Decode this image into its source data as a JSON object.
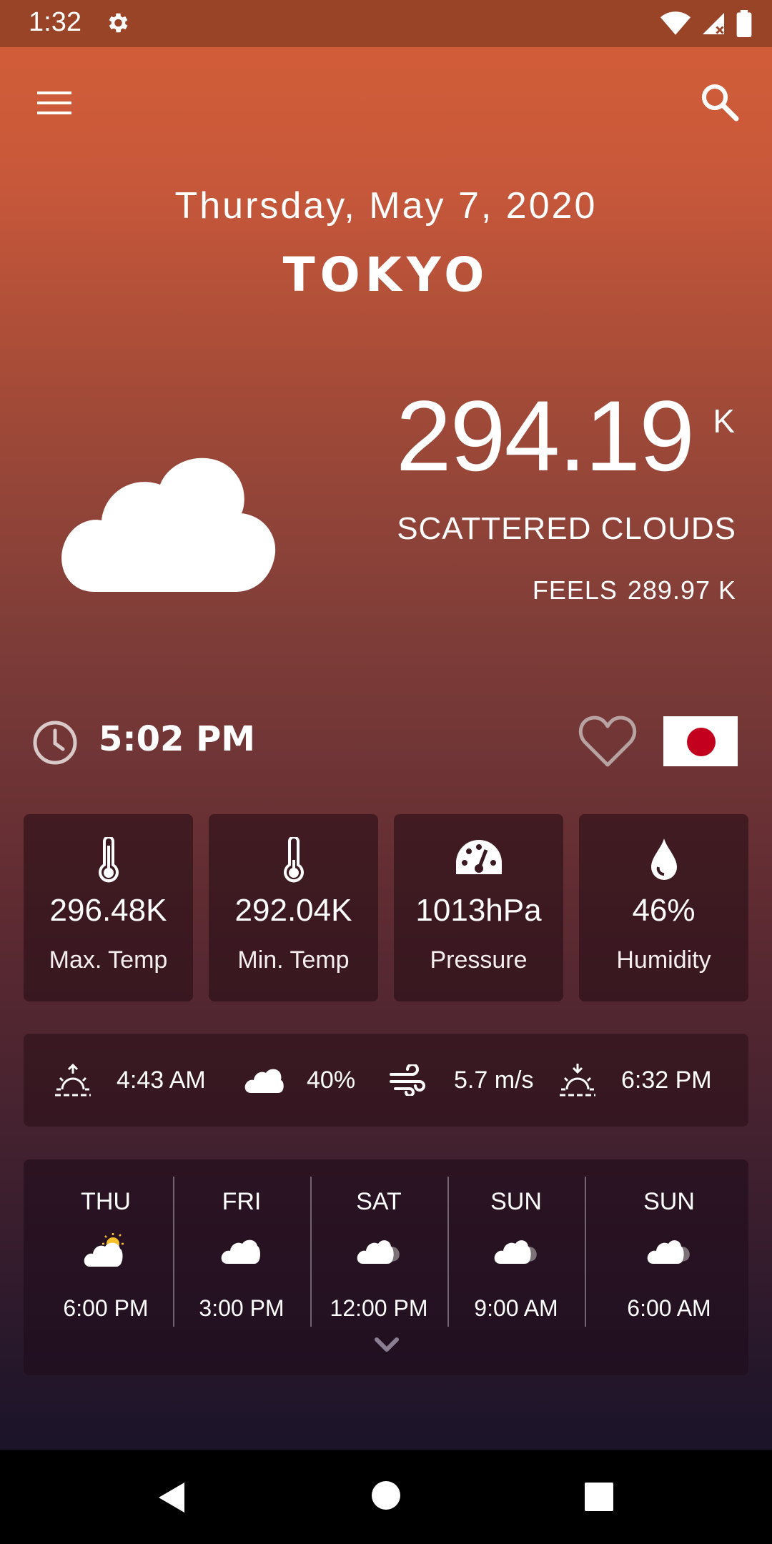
{
  "status_bar": {
    "time": "1:32"
  },
  "header": {
    "date": "Thursday, May 7, 2020",
    "city": "TOKYO"
  },
  "current": {
    "temperature": "294.19",
    "unit": "K",
    "condition": "SCATTERED CLOUDS",
    "feels_label": "FEELS",
    "feels_value": "289.97 K",
    "icon": "cloud-icon"
  },
  "local": {
    "time": "5:02 PM",
    "favorite": false,
    "country_flag": "japan-flag"
  },
  "stats": [
    {
      "value": "296.48K",
      "label": "Max. Temp",
      "icon": "thermometer-icon"
    },
    {
      "value": "292.04K",
      "label": "Min. Temp",
      "icon": "thermometer-icon"
    },
    {
      "value": "1013hPa",
      "label": "Pressure",
      "icon": "gauge-icon"
    },
    {
      "value": "46%",
      "label": "Humidity",
      "icon": "droplet-icon"
    }
  ],
  "details": {
    "sunrise": "4:43 AM",
    "cloudiness": "40%",
    "wind": "5.7 m/s",
    "sunset": "6:32 PM"
  },
  "forecast": [
    {
      "day": "THU",
      "time": "6:00 PM",
      "icon": "partly-sunny-icon"
    },
    {
      "day": "FRI",
      "time": "3:00 PM",
      "icon": "cloud-icon"
    },
    {
      "day": "SAT",
      "time": "12:00 PM",
      "icon": "clouds-icon"
    },
    {
      "day": "SUN",
      "time": "9:00 AM",
      "icon": "clouds-icon"
    },
    {
      "day": "SUN",
      "time": "6:00 AM",
      "icon": "clouds-icon"
    }
  ],
  "colors": {
    "accent": "#d45f38",
    "flag_red": "#c3001d",
    "heart": "#b8a3a3"
  }
}
